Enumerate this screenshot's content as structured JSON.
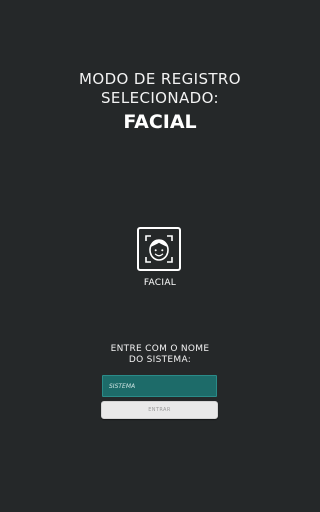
{
  "header": {
    "line1": "MODO DE REGISTRO",
    "line2": "SELECIONADO:",
    "mode": "FACIAL"
  },
  "facial_option": {
    "icon": "face-recognition-icon",
    "label": "FACIAL"
  },
  "system_prompt": {
    "line1": "ENTRE COM O NOME",
    "line2": "DO SISTEMA:"
  },
  "system_input": {
    "placeholder": "SISTEMA",
    "value": ""
  },
  "enter_button": {
    "label": "ENTRAR"
  },
  "colors": {
    "background": "#252829",
    "input_background": "#1d6b69",
    "button_background": "#e9e9e9"
  }
}
